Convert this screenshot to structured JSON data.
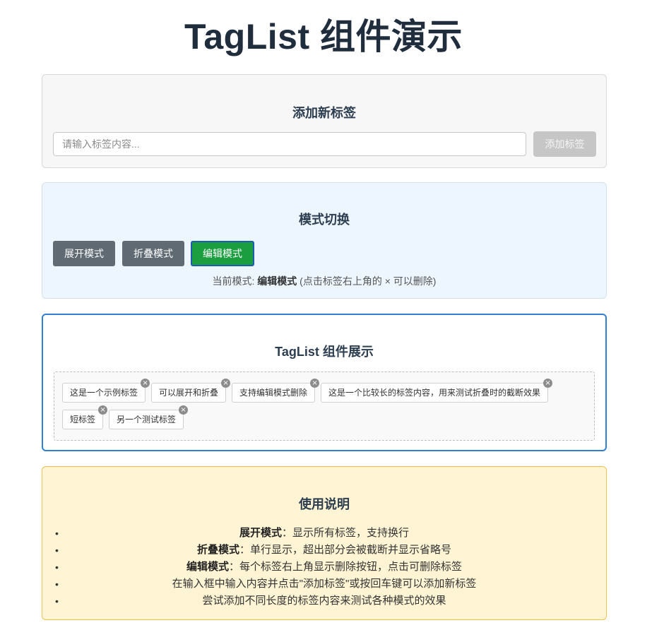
{
  "page": {
    "title": "TagList 组件演示"
  },
  "add_section": {
    "title": "添加新标签",
    "placeholder": "请输入标签内容...",
    "button_label": "添加标签"
  },
  "mode_section": {
    "title": "模式切换",
    "buttons": [
      {
        "label": "展开模式",
        "active": false
      },
      {
        "label": "折叠模式",
        "active": false
      },
      {
        "label": "编辑模式",
        "active": true
      }
    ],
    "status_prefix": "当前模式: ",
    "status_mode": "编辑模式",
    "status_suffix": " (点击标签右上角的 × 可以删除)"
  },
  "taglist_section": {
    "title": "TagList 组件展示",
    "close_symbol": "×",
    "tags": [
      "这是一个示例标签",
      "可以展开和折叠",
      "支持编辑模式删除",
      "这是一个比较长的标签内容，用来测试折叠时的截断效果",
      "短标签",
      "另一个测试标签"
    ]
  },
  "usage_section": {
    "title": "使用说明",
    "bullet": "•",
    "items": [
      {
        "bold": "展开模式",
        "text": "：显示所有标签，支持换行"
      },
      {
        "bold": "折叠模式",
        "text": "：单行显示，超出部分会被截断并显示省略号"
      },
      {
        "bold": "编辑模式",
        "text": "：每个标签右上角显示删除按钮，点击可删除标签"
      },
      {
        "bold": "",
        "text": "在输入框中输入内容并点击\"添加标签\"或按回车键可以添加新标签"
      },
      {
        "bold": "",
        "text": "尝试添加不同长度的标签内容来测试各种模式的效果"
      }
    ]
  },
  "colors": {
    "active_mode": "#1a9e3f",
    "mode_button": "#5f6a73",
    "taglist_border": "#2f7fd6",
    "usage_bg": "#fff4d4"
  }
}
